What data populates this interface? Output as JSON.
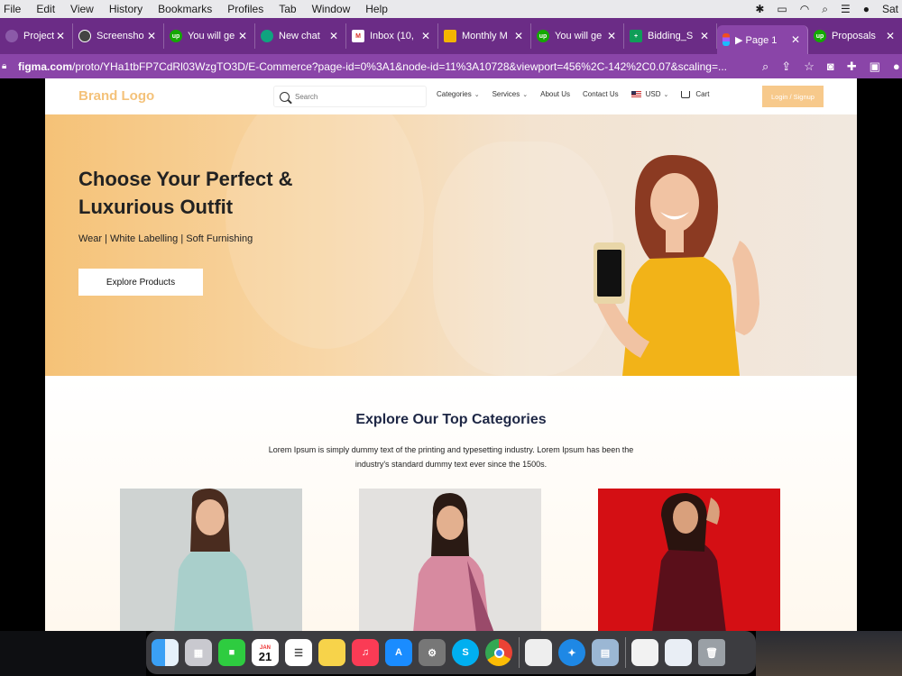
{
  "menubar": {
    "items": [
      "File",
      "Edit",
      "View",
      "History",
      "Bookmarks",
      "Profiles",
      "Tab",
      "Window",
      "Help"
    ],
    "clock": "Sat"
  },
  "tabs": [
    {
      "label": "Project Ca",
      "icon": "project-icon",
      "color": "#6b2c86"
    },
    {
      "label": "Screensho",
      "icon": "globe-icon",
      "color": "#444"
    },
    {
      "label": "You will ge",
      "icon": "upwork-icon",
      "color": "#14a800"
    },
    {
      "label": "New chat",
      "icon": "chatgpt-icon",
      "color": "#10a37f"
    },
    {
      "label": "Inbox (10,",
      "icon": "gmail-icon",
      "color": "#d93025"
    },
    {
      "label": "Monthly M",
      "icon": "slides-icon",
      "color": "#f4b400"
    },
    {
      "label": "You will ge",
      "icon": "upwork-icon",
      "color": "#14a800"
    },
    {
      "label": "Bidding_S",
      "icon": "sheets-icon",
      "color": "#0f9d58"
    },
    {
      "label": "▶ Page 1",
      "icon": "figma-icon",
      "color": "#a259ff"
    },
    {
      "label": "Proposals",
      "icon": "upwork-icon",
      "color": "#14a800"
    }
  ],
  "address": {
    "domain": "figma.com",
    "path": "/proto/YHa1tbFP7CdRl03WzgTO3D/E-Commerce?page-id=0%3A1&node-id=11%3A10728&viewport=456%2C-142%2C0.07&scaling=..."
  },
  "site": {
    "brand": "Brand Logo",
    "search_placeholder": "Search",
    "nav": {
      "categories": "Categories",
      "services": "Services",
      "about": "About Us",
      "contact": "Contact Us",
      "currency": "USD",
      "cart": "Cart",
      "login": "Login / Signup"
    },
    "hero": {
      "title": "Choose Your Perfect & Luxurious Outfit",
      "subtitle": "Wear | White Labelling | Soft Furnishing",
      "cta": "Explore Products"
    },
    "categories_section": {
      "title": "Explore Our Top Categories",
      "description": "Lorem Ipsum is simply dummy text of the printing and typesetting industry. Lorem Ipsum has been the industry's standard dummy text ever since the 1500s."
    }
  },
  "dock": {
    "calendar_month": "JAN",
    "calendar_day": "21"
  },
  "colors": {
    "browser_purple": "#6b2c86",
    "brand_accent": "#f4c27a",
    "heading_navy": "#1e2745"
  }
}
